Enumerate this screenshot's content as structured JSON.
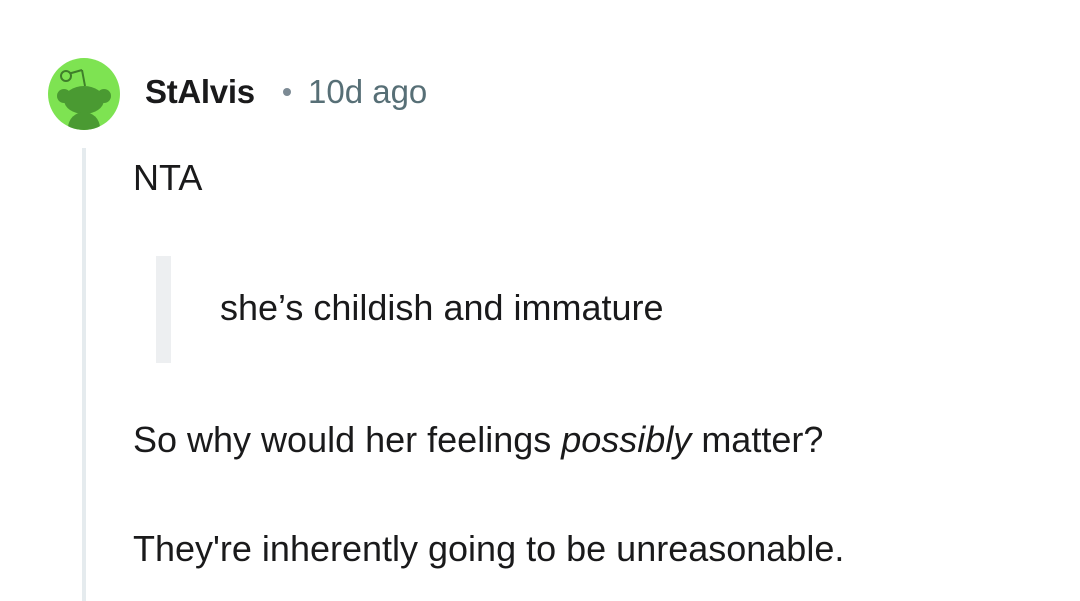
{
  "comment": {
    "author": "StAlvis",
    "separator_icon": "dot-separator-icon",
    "timestamp": "10d ago",
    "avatar_icon": "snoo-avatar-icon",
    "colors": {
      "avatar_bg": "#7ee352",
      "snoo": "#4a9a32",
      "timestamp": "#576f76",
      "thread_line": "#e5ebee",
      "quote_bar": "#edeff1"
    },
    "paragraphs": {
      "p1": "NTA",
      "quote": "she’s childish and immature",
      "p2_before": "So why would her feelings ",
      "p2_italic": "possibly",
      "p2_after": " matter?",
      "p3": "They're inherently going to be unreasonable."
    }
  }
}
